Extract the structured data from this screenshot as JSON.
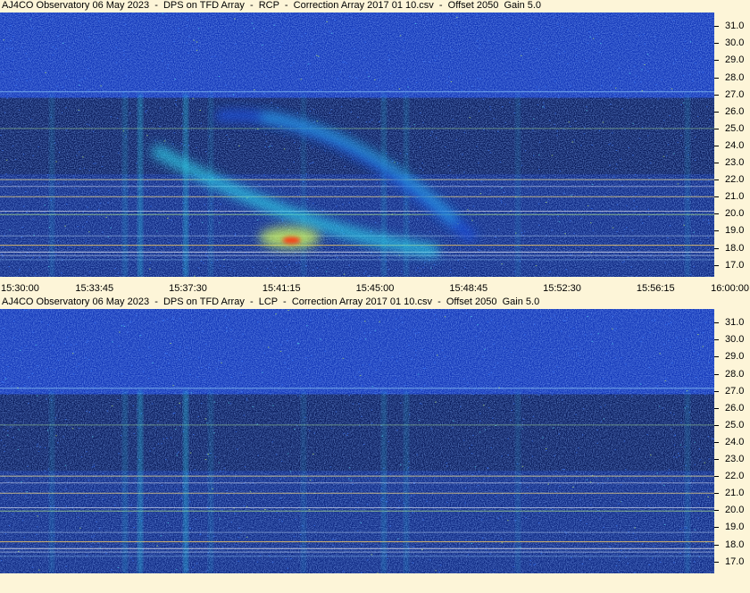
{
  "chart_data": [
    {
      "type": "heatmap",
      "title": "AJ4CO Observatory 06 May 2023  -  DPS on TFD Array  -  RCP  -  Correction Array 2017 01 10.csv  -  Offset 2050  Gain 5.0",
      "polarization": "RCP",
      "x_tick_labels": [
        "15:30:00",
        "15:33:45",
        "15:37:30",
        "15:41:15",
        "15:45:00",
        "15:48:45",
        "15:52:30",
        "15:56:15",
        "16:00:00"
      ],
      "y_tick_labels": [
        "31.0",
        "30.0",
        "29.0",
        "28.0",
        "27.0",
        "26.0",
        "25.0",
        "24.0",
        "23.0",
        "22.0",
        "21.0",
        "20.0",
        "19.0",
        "18.0",
        "17.0"
      ],
      "x_range": [
        "15:30:00",
        "16:00:00"
      ],
      "y_range": [
        16.3,
        31.8
      ],
      "colormap": [
        "#0a1e70",
        "#1d4fd8",
        "#2fd0e8",
        "#c8f060",
        "#ffd020",
        "#ff3010"
      ],
      "features": [
        {
          "label": "emission arc",
          "time_start": "15:36:50",
          "time_end": "15:49:30",
          "freq_start": 18.0,
          "freq_end": 26.0
        },
        {
          "label": "peak emission",
          "time": "15:42:10",
          "freq": 18.6
        }
      ]
    },
    {
      "type": "heatmap",
      "title": "AJ4CO Observatory 06 May 2023  -  DPS on TFD Array  -  LCP  -  Correction Array 2017 01 10.csv  -  Offset 2050  Gain 5.0",
      "polarization": "LCP",
      "x_tick_labels": [],
      "y_tick_labels": [
        "31.0",
        "30.0",
        "29.0",
        "28.0",
        "27.0",
        "26.0",
        "25.0",
        "24.0",
        "23.0",
        "22.0",
        "21.0",
        "20.0",
        "19.0",
        "18.0",
        "17.0"
      ],
      "x_range": [
        "15:30:00",
        "16:00:00"
      ],
      "y_range": [
        16.3,
        31.8
      ],
      "colormap": [
        "#0a1e70",
        "#1d4fd8",
        "#2fd0e8",
        "#c8f060",
        "#ffd020",
        "#ff3010"
      ],
      "features": []
    }
  ]
}
